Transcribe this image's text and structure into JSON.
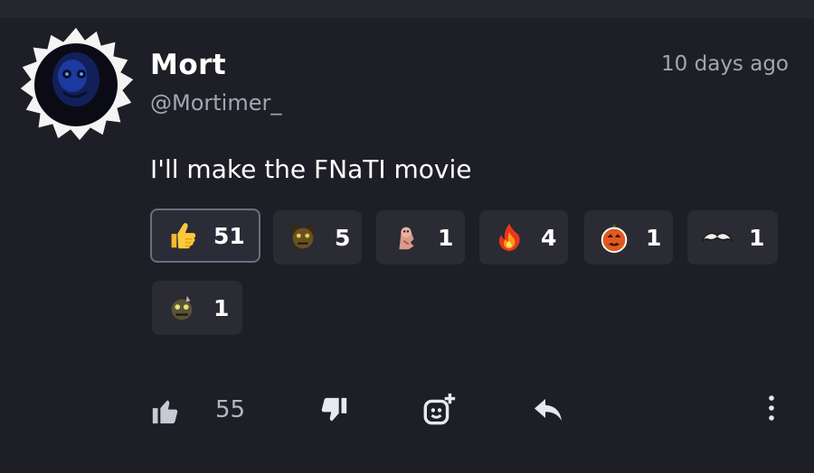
{
  "comment": {
    "author": "Mort",
    "handle": "@Mortimer_",
    "timestamp": "10 days ago",
    "text": "I'll make the FNaTI movie"
  },
  "reactions": [
    {
      "emoji": "thumbs-up-emoji",
      "count": "51",
      "selected": true
    },
    {
      "emoji": "bear-head-emoji",
      "count": "5",
      "selected": false
    },
    {
      "emoji": "pink-ghost-emoji",
      "count": "1",
      "selected": false
    },
    {
      "emoji": "fire-emoji",
      "count": "4",
      "selected": false
    },
    {
      "emoji": "jack-o-lantern-emoji",
      "count": "1",
      "selected": false
    },
    {
      "emoji": "mustache-emoji",
      "count": "1",
      "selected": false
    },
    {
      "emoji": "skull-creature-emoji",
      "count": "1",
      "selected": false
    }
  ],
  "actions": {
    "like_count": "55",
    "like_icon": "thumbs-up-icon",
    "dislike_icon": "thumbs-down-icon",
    "add_reaction_icon": "add-reaction-icon",
    "reply_icon": "reply-icon",
    "more_icon": "more-vertical-icon"
  },
  "colors": {
    "background": "#1e1f26",
    "chip": "#2a2b33",
    "chip_selected_border": "#6b6e7c",
    "muted_text": "#a3a5b0"
  }
}
